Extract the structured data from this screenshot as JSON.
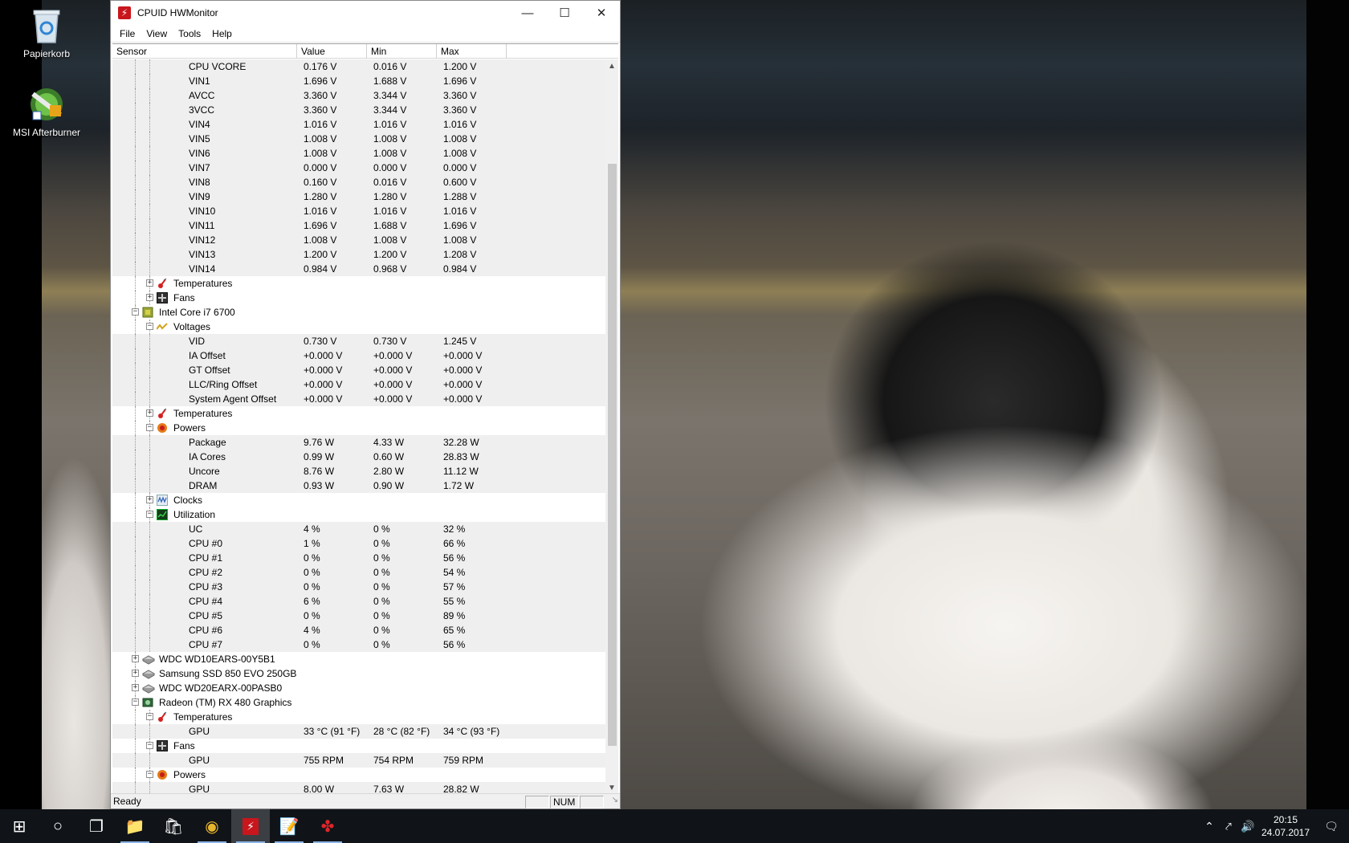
{
  "desktop": {
    "icons": [
      {
        "label": "Papierkorb"
      },
      {
        "label": "MSI Afterburner"
      }
    ]
  },
  "window": {
    "title": "CPUID HWMonitor",
    "menus": [
      "File",
      "View",
      "Tools",
      "Help"
    ],
    "columns": [
      "Sensor",
      "Value",
      "Min",
      "Max"
    ],
    "status_text": "Ready",
    "status_num": "NUM"
  },
  "rows": [
    {
      "type": "sensor",
      "label": "CPU VCORE",
      "value": "0.176 V",
      "min": "0.016 V",
      "max": "1.200 V"
    },
    {
      "type": "sensor",
      "label": "VIN1",
      "value": "1.696 V",
      "min": "1.688 V",
      "max": "1.696 V"
    },
    {
      "type": "sensor",
      "label": "AVCC",
      "value": "3.360 V",
      "min": "3.344 V",
      "max": "3.360 V"
    },
    {
      "type": "sensor",
      "label": "3VCC",
      "value": "3.360 V",
      "min": "3.344 V",
      "max": "3.360 V"
    },
    {
      "type": "sensor",
      "label": "VIN4",
      "value": "1.016 V",
      "min": "1.016 V",
      "max": "1.016 V"
    },
    {
      "type": "sensor",
      "label": "VIN5",
      "value": "1.008 V",
      "min": "1.008 V",
      "max": "1.008 V"
    },
    {
      "type": "sensor",
      "label": "VIN6",
      "value": "1.008 V",
      "min": "1.008 V",
      "max": "1.008 V"
    },
    {
      "type": "sensor",
      "label": "VIN7",
      "value": "0.000 V",
      "min": "0.000 V",
      "max": "0.000 V"
    },
    {
      "type": "sensor",
      "label": "VIN8",
      "value": "0.160 V",
      "min": "0.016 V",
      "max": "0.600 V"
    },
    {
      "type": "sensor",
      "label": "VIN9",
      "value": "1.280 V",
      "min": "1.280 V",
      "max": "1.288 V"
    },
    {
      "type": "sensor",
      "label": "VIN10",
      "value": "1.016 V",
      "min": "1.016 V",
      "max": "1.016 V"
    },
    {
      "type": "sensor",
      "label": "VIN11",
      "value": "1.696 V",
      "min": "1.688 V",
      "max": "1.696 V"
    },
    {
      "type": "sensor",
      "label": "VIN12",
      "value": "1.008 V",
      "min": "1.008 V",
      "max": "1.008 V"
    },
    {
      "type": "sensor",
      "label": "VIN13",
      "value": "1.200 V",
      "min": "1.200 V",
      "max": "1.208 V"
    },
    {
      "type": "sensor",
      "label": "VIN14",
      "value": "0.984 V",
      "min": "0.968 V",
      "max": "0.984 V"
    },
    {
      "type": "group",
      "label": "Temperatures",
      "icon": "thermometer-icon",
      "expanded": false
    },
    {
      "type": "group",
      "label": "Fans",
      "icon": "fan-icon",
      "expanded": false
    },
    {
      "type": "device",
      "label": "Intel Core i7 6700",
      "icon": "cpu-chip-icon",
      "expanded": true
    },
    {
      "type": "group",
      "label": "Voltages",
      "icon": "voltage-icon",
      "expanded": true
    },
    {
      "type": "sensor",
      "label": "VID",
      "value": "0.730 V",
      "min": "0.730 V",
      "max": "1.245 V"
    },
    {
      "type": "sensor",
      "label": "IA Offset",
      "value": "+0.000 V",
      "min": "+0.000 V",
      "max": "+0.000 V"
    },
    {
      "type": "sensor",
      "label": "GT Offset",
      "value": "+0.000 V",
      "min": "+0.000 V",
      "max": "+0.000 V"
    },
    {
      "type": "sensor",
      "label": "LLC/Ring Offset",
      "value": "+0.000 V",
      "min": "+0.000 V",
      "max": "+0.000 V"
    },
    {
      "type": "sensor",
      "label": "System Agent Offset",
      "value": "+0.000 V",
      "min": "+0.000 V",
      "max": "+0.000 V"
    },
    {
      "type": "group",
      "label": "Temperatures",
      "icon": "thermometer-icon",
      "expanded": false
    },
    {
      "type": "group",
      "label": "Powers",
      "icon": "power-icon",
      "expanded": true
    },
    {
      "type": "sensor",
      "label": "Package",
      "value": "9.76 W",
      "min": "4.33 W",
      "max": "32.28 W"
    },
    {
      "type": "sensor",
      "label": "IA Cores",
      "value": "0.99 W",
      "min": "0.60 W",
      "max": "28.83 W"
    },
    {
      "type": "sensor",
      "label": "Uncore",
      "value": "8.76 W",
      "min": "2.80 W",
      "max": "11.12 W"
    },
    {
      "type": "sensor",
      "label": "DRAM",
      "value": "0.93 W",
      "min": "0.90 W",
      "max": "1.72 W"
    },
    {
      "type": "group",
      "label": "Clocks",
      "icon": "clock-wave-icon",
      "expanded": false
    },
    {
      "type": "group",
      "label": "Utilization",
      "icon": "utilization-icon",
      "expanded": true
    },
    {
      "type": "sensor",
      "label": "UC",
      "value": "4 %",
      "min": "0 %",
      "max": "32 %"
    },
    {
      "type": "sensor",
      "label": "CPU #0",
      "value": "1 %",
      "min": "0 %",
      "max": "66 %"
    },
    {
      "type": "sensor",
      "label": "CPU #1",
      "value": "0 %",
      "min": "0 %",
      "max": "56 %"
    },
    {
      "type": "sensor",
      "label": "CPU #2",
      "value": "0 %",
      "min": "0 %",
      "max": "54 %"
    },
    {
      "type": "sensor",
      "label": "CPU #3",
      "value": "0 %",
      "min": "0 %",
      "max": "57 %"
    },
    {
      "type": "sensor",
      "label": "CPU #4",
      "value": "6 %",
      "min": "0 %",
      "max": "55 %"
    },
    {
      "type": "sensor",
      "label": "CPU #5",
      "value": "0 %",
      "min": "0 %",
      "max": "89 %"
    },
    {
      "type": "sensor",
      "label": "CPU #6",
      "value": "4 %",
      "min": "0 %",
      "max": "65 %"
    },
    {
      "type": "sensor",
      "label": "CPU #7",
      "value": "0 %",
      "min": "0 %",
      "max": "56 %"
    },
    {
      "type": "device",
      "label": "WDC WD10EARS-00Y5B1",
      "icon": "hard-drive-icon",
      "expanded": false
    },
    {
      "type": "device",
      "label": "Samsung SSD 850 EVO 250GB",
      "icon": "hard-drive-icon",
      "expanded": false
    },
    {
      "type": "device",
      "label": "WDC WD20EARX-00PASB0",
      "icon": "hard-drive-icon",
      "expanded": false
    },
    {
      "type": "device",
      "label": "Radeon (TM) RX 480 Graphics",
      "icon": "graphics-card-icon",
      "expanded": true
    },
    {
      "type": "group",
      "label": "Temperatures",
      "icon": "thermometer-icon",
      "expanded": true
    },
    {
      "type": "sensor",
      "label": "GPU",
      "value": "33 °C  (91 °F)",
      "min": "28 °C  (82 °F)",
      "max": "34 °C  (93 °F)"
    },
    {
      "type": "group",
      "label": "Fans",
      "icon": "fan-icon",
      "expanded": true
    },
    {
      "type": "sensor",
      "label": "GPU",
      "value": "755 RPM",
      "min": "754 RPM",
      "max": "759 RPM"
    },
    {
      "type": "group",
      "label": "Powers",
      "icon": "power-icon",
      "expanded": true
    },
    {
      "type": "sensor",
      "label": "GPU",
      "value": "8.00 W",
      "min": "7.63 W",
      "max": "28.82 W"
    }
  ],
  "taskbar": {
    "apps": [
      {
        "name": "start-button",
        "glyph": "⊞"
      },
      {
        "name": "cortana-button",
        "glyph": "○"
      },
      {
        "name": "task-view-button",
        "glyph": "❐"
      },
      {
        "name": "file-explorer-button",
        "glyph": "📁"
      },
      {
        "name": "store-button",
        "glyph": "🛍"
      },
      {
        "name": "chrome-button",
        "glyph": "◉"
      },
      {
        "name": "hwmonitor-taskbar-button",
        "glyph": "⚡"
      },
      {
        "name": "notepad-taskbar-button",
        "glyph": "📝"
      },
      {
        "name": "misc-app-button",
        "glyph": "✤"
      }
    ],
    "time": "20:15",
    "date": "24.07.2017"
  },
  "colors": {
    "taskbar_bg": "#101418",
    "row_alt": "#efefef",
    "app_icon": "#c8161c"
  }
}
